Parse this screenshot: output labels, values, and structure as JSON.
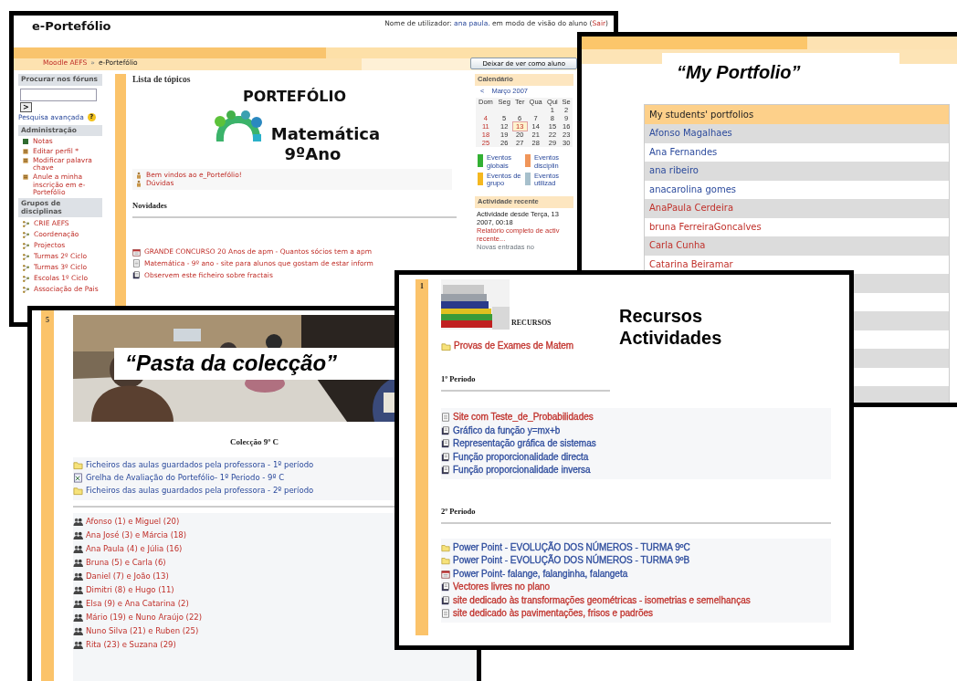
{
  "main_window": {
    "title": "e-Portefólio",
    "user_line": {
      "prefix": "Nome de utilizador:",
      "user": "ana paula.",
      "middle": "em modo de visão do aluno (",
      "logout": "Sair",
      "suffix": ")"
    },
    "breadcrumb": {
      "home": "Moodle AEFS",
      "separator": "»",
      "current": "e-Portefólio"
    },
    "switch_role_button": "Deixar de ver como aluno",
    "sidebar": {
      "search_block": {
        "title": "Procurar nos fóruns",
        "go_button": ">",
        "advanced_link": "Pesquisa avançada",
        "help": "?"
      },
      "admin_block": {
        "title": "Administração",
        "items": [
          {
            "label": "Notas",
            "kind": "grades"
          },
          {
            "label": "Editar perfil *",
            "kind": "figure"
          },
          {
            "label": "Modificar palavra chave",
            "kind": "figure"
          },
          {
            "label": "Anule a minha inscrição em e-Portefólio",
            "kind": "figure"
          }
        ]
      },
      "groups_block": {
        "title": "Grupos de disciplinas",
        "items": [
          "CRIE AEFS",
          "Coordenação",
          "Projectos",
          "Turmas 2º Ciclo",
          "Turmas 3º Ciclo",
          "Escolas 1º Ciclo",
          "Associação de Pais"
        ]
      }
    },
    "center": {
      "heading": "Lista de tópicos",
      "title": "PORTEFÓLIO",
      "subtitle": "Matemática",
      "grade": "9ºAno",
      "links": [
        "Bem vindos ao e_Portefólio!",
        "Dúvidas"
      ],
      "news_heading": "Novidades",
      "news": [
        {
          "label": "GRANDE CONCURSO 20 Anos de apm - Quantos sócios tem a apm",
          "kind": "calendar"
        },
        {
          "label": "Matemática - 9º ano - site para alunos que gostam de estar inform",
          "kind": "page"
        },
        {
          "label": "Observem este ficheiro sobre fractais",
          "kind": "doc"
        }
      ]
    },
    "calendar": {
      "title": "Calendário",
      "prev": "<",
      "month": "Março 2007",
      "weekdays": [
        "Dom",
        "Seg",
        "Ter",
        "Qua",
        "Qui",
        "Se"
      ],
      "weeks": [
        [
          {
            "label": "1",
            "today": false
          },
          {
            "label": "2",
            "today": false
          }
        ],
        [
          {
            "label": "4",
            "today": false
          },
          {
            "label": "5",
            "today": false
          },
          {
            "label": "6",
            "today": false
          },
          {
            "label": "7",
            "today": false
          },
          {
            "label": "8",
            "today": false
          },
          {
            "label": "9",
            "today": false
          }
        ],
        [
          {
            "label": "11",
            "today": false
          },
          {
            "label": "12",
            "today": false
          },
          {
            "label": "13",
            "today": true
          },
          {
            "label": "14",
            "today": false
          },
          {
            "label": "15",
            "today": false
          },
          {
            "label": "16",
            "today": false
          }
        ],
        [
          {
            "label": "18",
            "today": false
          },
          {
            "label": "19",
            "today": false
          },
          {
            "label": "20",
            "today": false
          },
          {
            "label": "21",
            "today": false
          },
          {
            "label": "22",
            "today": false
          },
          {
            "label": "23",
            "today": false
          }
        ],
        [
          {
            "label": "25",
            "today": false
          },
          {
            "label": "26",
            "today": false
          },
          {
            "label": "27",
            "today": false
          },
          {
            "label": "28",
            "today": false
          },
          {
            "label": "29",
            "today": false
          },
          {
            "label": "30",
            "today": false
          }
        ]
      ],
      "legend": [
        {
          "label": "Eventos globais",
          "color": "#33b033"
        },
        {
          "label": "Eventos disciplin",
          "color": "#f0965a"
        },
        {
          "label": "Eventos de grupo",
          "color": "#f5b820"
        },
        {
          "label": "Eventos utilizad",
          "color": "#a7c0cc"
        }
      ]
    },
    "recent": {
      "title": "Actividade recente",
      "lines": [
        "Actividade desde Terça, 13",
        "2007, 00:18"
      ],
      "report_link": [
        "Relatório completo de activ",
        "recente..."
      ],
      "glossary": "Novas entradas no"
    }
  },
  "portfolio_window": {
    "caption": "“My Portfolio”",
    "table_header": "My students' portfolios",
    "students": [
      {
        "name": "Afonso Magalhaes",
        "color": "#2b4a9c"
      },
      {
        "name": "Ana Fernandes",
        "color": "#2b4a9c"
      },
      {
        "name": "ana ribeiro",
        "color": "#2b4a9c"
      },
      {
        "name": "anacarolina gomes",
        "color": "#2b4a9c"
      },
      {
        "name": "AnaPaula Cerdeira",
        "color": "#c0302a"
      },
      {
        "name": "bruna FerreiraGoncalves",
        "color": "#c0302a"
      },
      {
        "name": "Carla Cunha",
        "color": "#c0302a"
      },
      {
        "name": "Catarina Beiramar",
        "color": "#c0302a"
      }
    ]
  },
  "collection_window": {
    "section_number": "5",
    "caption": "“Pasta da colecção”",
    "heading": "Colecção 9º C",
    "files": [
      {
        "label": "Ficheiros das aulas guardados pela professora - 1º período",
        "kind": "folder"
      },
      {
        "label": "Grelha de Avaliação do Portefólio- 1º Periodo - 9º C",
        "kind": "sheet"
      },
      {
        "label": "Ficheiros das aulas guardados pela professora - 2º período",
        "kind": "folder"
      }
    ],
    "pairs": [
      "Afonso (1) e Miguel (20)",
      "Ana José (3) e Márcia (18)",
      "Ana Paula (4) e Júlia (16)",
      "Bruna (5) e Carla (6)",
      "Daniel (7) e João (13)",
      "Dimitri (8) e Hugo (11)",
      "Elsa (9) e Ana Catarina (2)",
      "Mário (19) e Nuno Araújo (22)",
      "Nuno Silva (21) e Ruben (25)",
      "Rita (23) e Suzana (29)"
    ]
  },
  "resources_window": {
    "section_number": "1",
    "label": "RECURSOS",
    "caption": [
      "Recursos",
      "Actividades"
    ],
    "exam_link": {
      "label": "Provas de Exames de Matem",
      "kind": "folder",
      "color": "#c0302a"
    },
    "periods": [
      {
        "title": "1º Periodo",
        "items": [
          {
            "label": "Site com Teste_de_Probabilidades",
            "kind": "page",
            "color": "#c0302a"
          },
          {
            "label": "Gráfico da função y=mx+b",
            "kind": "doc",
            "color": "#2b4a9c"
          },
          {
            "label": "Representação gráfica de sistemas",
            "kind": "doc",
            "color": "#2b4a9c"
          },
          {
            "label": "Função proporcionalidade directa",
            "kind": "doc",
            "color": "#2b4a9c"
          },
          {
            "label": "Função proporcionalidade inversa",
            "kind": "doc",
            "color": "#2b4a9c"
          }
        ]
      },
      {
        "title": "2º Periodo",
        "items": [
          {
            "label": "Power Point - EVOLUÇÃO DOS NÚMEROS - TURMA 9ºC",
            "kind": "folder",
            "color": "#2b4a9c"
          },
          {
            "label": "Power Point - EVOLUÇÃO DOS NÚMEROS - TURMA 9ºB",
            "kind": "folder",
            "color": "#2b4a9c"
          },
          {
            "label": "Power Point- falange, falanginha, falangeta",
            "kind": "calendar",
            "color": "#2b4a9c"
          },
          {
            "label": "Vectores livres no plano",
            "kind": "doc",
            "color": "#c0302a"
          },
          {
            "label": "site dedicado às transformações geométricas - isometrias e semelhanças",
            "kind": "doc",
            "color": "#c0302a"
          },
          {
            "label": "site dedicado às pavimentações, frisos e padrões",
            "kind": "page",
            "color": "#c0302a"
          }
        ]
      }
    ]
  }
}
